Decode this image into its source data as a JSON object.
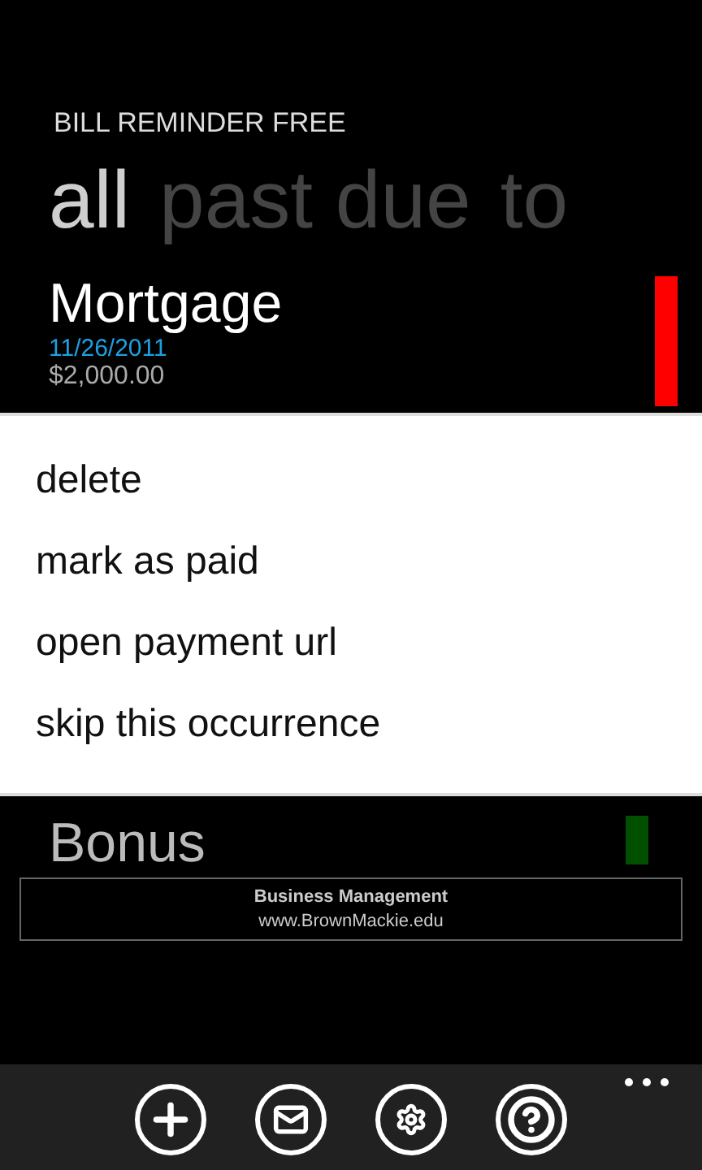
{
  "app_title": "BILL REMINDER FREE",
  "pivots": [
    {
      "label": "all",
      "selected": true
    },
    {
      "label": "past due",
      "selected": false
    },
    {
      "label": "to",
      "selected": false
    }
  ],
  "bills": [
    {
      "name": "Mortgage",
      "date": "11/26/2011",
      "amount": "$2,000.00",
      "color": "#ff0000"
    },
    {
      "name": "Bonus",
      "color": "#005000"
    }
  ],
  "context_menu": [
    "delete",
    "mark as paid",
    "open payment url",
    "skip this occurrence"
  ],
  "ad": {
    "title": "Business Management",
    "url": "www.BrownMackie.edu"
  },
  "app_bar": [
    {
      "kind": "add"
    },
    {
      "kind": "mail"
    },
    {
      "kind": "settings"
    },
    {
      "kind": "help"
    }
  ]
}
